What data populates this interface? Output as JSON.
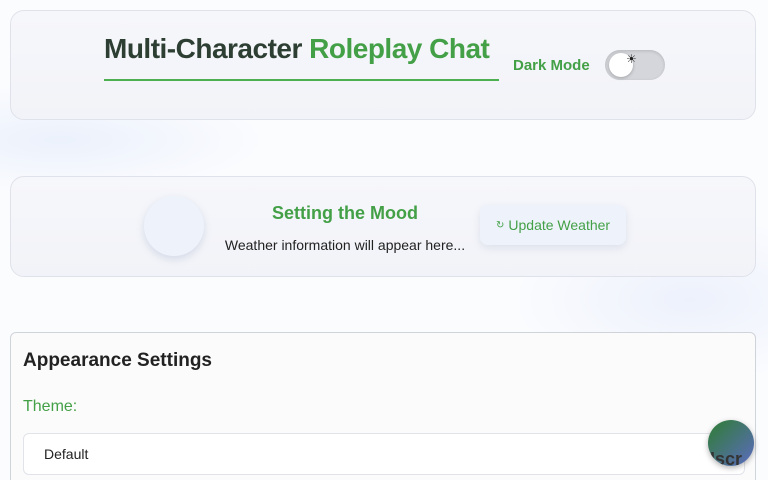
{
  "header": {
    "title_part1": "Multi-Character",
    "title_part2": "Roleplay Chat",
    "dark_mode_label": "Dark Mode",
    "dark_mode_on": false,
    "toggle_icon": "sun-icon",
    "toggle_glyph": "☀"
  },
  "weather": {
    "icon": "weather-icon",
    "icon_glyph": "",
    "title": "Setting the Mood",
    "text": "Weather information will appear here...",
    "update_button_label": "Update Weather",
    "update_button_icon": "↻"
  },
  "appearance": {
    "title": "Appearance Settings",
    "theme_label": "Theme:",
    "theme_selected": "Default"
  },
  "floating_button": {
    "icon": "",
    "label": "Iscr"
  },
  "colors": {
    "accent_green": "#43a047",
    "dark_text": "#2d3e33"
  }
}
